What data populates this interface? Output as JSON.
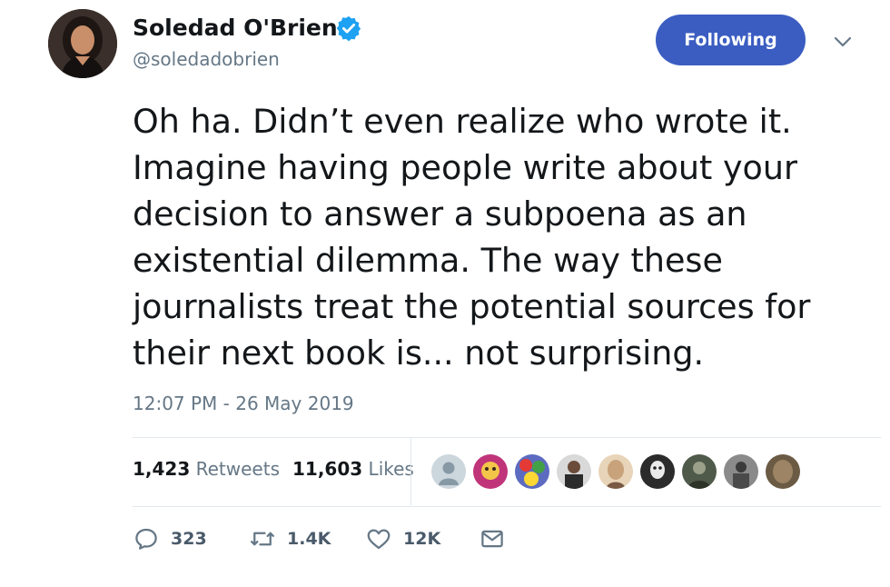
{
  "user": {
    "display_name": "Soledad O'Brien",
    "handle": "@soledadobrien",
    "verified": true,
    "avatar_icon": "profile-photo"
  },
  "follow_button": {
    "label": "Following",
    "color": "#3b5dc2"
  },
  "menu": {
    "icon": "chevron-down-icon"
  },
  "tweet": {
    "text": "Oh ha. Didn’t even realize who wrote it.\nImagine having people write about your\ndecision to answer a subpoena as an\nexistential dilemma. The way these\njournalists treat the potential sources for\ntheir next book is... not surprising.",
    "timestamp": "12:07 PM - 26 May 2019"
  },
  "stats": {
    "retweets_count": "1,423",
    "retweets_label": "Retweets",
    "likes_count": "11,603",
    "likes_label": "Likes"
  },
  "liker_avatars": [
    {
      "name": "default-avatar-icon",
      "color": "#ccd6dd"
    },
    {
      "name": "liker-avatar",
      "color": "#c0347a"
    },
    {
      "name": "liker-avatar",
      "color": "#5c6bc0"
    },
    {
      "name": "liker-avatar",
      "color": "#3b3b3b"
    },
    {
      "name": "liker-avatar",
      "color": "#c8a27a"
    },
    {
      "name": "liker-avatar",
      "color": "#2b2b2b"
    },
    {
      "name": "liker-avatar",
      "color": "#4f5a4a"
    },
    {
      "name": "liker-avatar",
      "color": "#6b6b6b"
    },
    {
      "name": "liker-avatar",
      "color": "#6b5a44"
    }
  ],
  "actions": {
    "reply": {
      "icon": "reply-icon",
      "count": "323"
    },
    "retweet": {
      "icon": "retweet-icon",
      "count": "1.4K"
    },
    "like": {
      "icon": "heart-icon",
      "count": "12K"
    },
    "dm": {
      "icon": "envelope-icon"
    }
  }
}
